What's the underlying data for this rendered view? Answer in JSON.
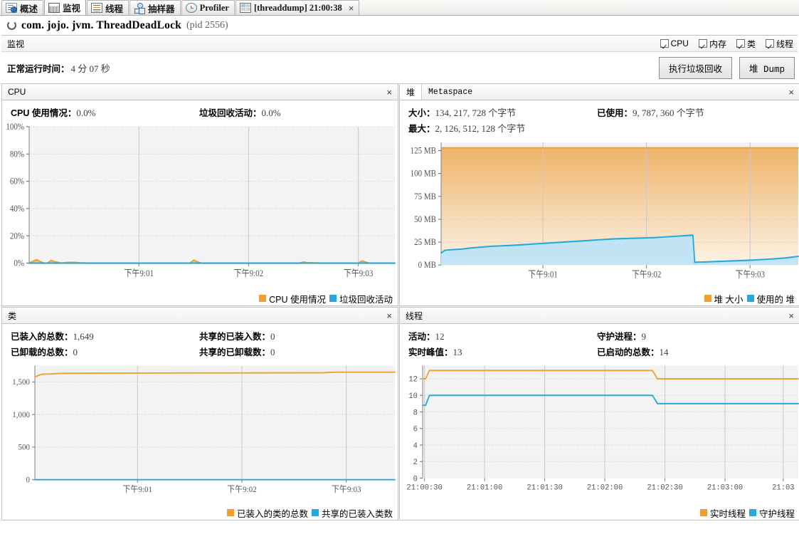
{
  "tabs": [
    {
      "label": "概述",
      "icon": "overview-icon",
      "active": false,
      "closable": false
    },
    {
      "label": "监视",
      "icon": "monitor-icon",
      "active": true,
      "closable": false
    },
    {
      "label": "线程",
      "icon": "threads-icon",
      "active": false,
      "closable": false
    },
    {
      "label": "抽样器",
      "icon": "sampler-icon",
      "active": false,
      "closable": false
    },
    {
      "label": "Profiler",
      "icon": "profiler-icon",
      "active": false,
      "closable": false
    },
    {
      "label": "[threaddump] 21:00:38",
      "icon": "threaddump-icon",
      "active": false,
      "closable": true
    }
  ],
  "tab_close_glyph": "×",
  "app": {
    "title": "com. jojo. jvm. ThreadDeadLock",
    "pid": "(pid 2556)"
  },
  "monitor_bar": {
    "label": "监视",
    "checkboxes": [
      {
        "label": "CPU",
        "checked": true
      },
      {
        "label": "内存",
        "checked": true
      },
      {
        "label": "类",
        "checked": true
      },
      {
        "label": "线程",
        "checked": true
      }
    ]
  },
  "uptime": {
    "label": "正常运行时间：",
    "value": "4 分 07 秒"
  },
  "actions": {
    "gc_button": "执行垃圾回收",
    "heapdump_button": "堆 Dump"
  },
  "panels": {
    "cpu": {
      "title": "CPU",
      "close_glyph": "×",
      "stats": [
        {
          "label": "CPU 使用情况：",
          "value": "0.0%"
        },
        {
          "label": "垃圾回收活动：",
          "value": "0.0%"
        }
      ],
      "legend": [
        {
          "label": "CPU 使用情况",
          "color": "#f0a030"
        },
        {
          "label": "垃圾回收活动",
          "color": "#27a8dd"
        }
      ]
    },
    "heap": {
      "tab_active": "堆",
      "tab_inactive": "Metaspace",
      "close_glyph": "×",
      "stats": [
        {
          "label": "大小：",
          "value": "134, 217, 728 个字节"
        },
        {
          "label": "最大：",
          "value": "2, 126, 512, 128 个字节"
        },
        {
          "label": "已使用：",
          "value": "9, 787, 360 个字节"
        }
      ],
      "legend": [
        {
          "label": "堆 大小",
          "color": "#f0a030"
        },
        {
          "label": "使用的 堆",
          "color": "#27a8dd"
        }
      ]
    },
    "classes": {
      "title": "类",
      "close_glyph": "×",
      "stats": [
        {
          "label": "已装入的总数：",
          "value": "1,649"
        },
        {
          "label": "已卸载的总数：",
          "value": "0"
        },
        {
          "label": "共享的已装入数：",
          "value": "0"
        },
        {
          "label": "共享的已卸载数：",
          "value": "0"
        }
      ],
      "legend": [
        {
          "label": "已装入的类的总数",
          "color": "#f0a030"
        },
        {
          "label": "共享的已装入类数",
          "color": "#27a8dd"
        }
      ]
    },
    "threads": {
      "title": "线程",
      "close_glyph": "×",
      "stats": [
        {
          "label": "活动：",
          "value": "12"
        },
        {
          "label": "实时峰值：",
          "value": "13"
        },
        {
          "label": "守护进程：",
          "value": "9"
        },
        {
          "label": "已启动的总数：",
          "value": "14"
        }
      ],
      "legend": [
        {
          "label": "实时线程",
          "color": "#f0a030"
        },
        {
          "label": "守护线程",
          "color": "#27a8dd"
        }
      ]
    }
  },
  "chart_data": [
    {
      "id": "cpu",
      "type": "area",
      "title": "CPU",
      "xlabel": "",
      "ylabel": "",
      "ylim": [
        0,
        100
      ],
      "yticks": [
        0,
        20,
        40,
        60,
        80,
        100
      ],
      "ytick_labels": [
        "0%",
        "20%",
        "40%",
        "60%",
        "80%",
        "100%"
      ],
      "xtick_labels": [
        "下午9:01",
        "下午9:02",
        "下午9:03"
      ],
      "xtick_positions": [
        0.3,
        0.6,
        0.9
      ],
      "grid": true,
      "series": [
        {
          "name": "CPU 使用情况",
          "color": "#f0a030",
          "x": [
            0.0,
            0.02,
            0.03,
            0.04,
            0.05,
            0.06,
            0.07,
            0.09,
            0.1,
            0.12,
            0.14,
            0.16,
            0.2,
            0.25,
            0.3,
            0.35,
            0.4,
            0.44,
            0.45,
            0.46,
            0.47,
            0.5,
            0.55,
            0.6,
            0.65,
            0.7,
            0.74,
            0.75,
            0.76,
            0.8,
            0.85,
            0.9,
            0.91,
            0.92,
            0.93,
            0.95,
            1.0
          ],
          "values": [
            0,
            2.5,
            1.2,
            0,
            0,
            2.0,
            1.0,
            0,
            0.4,
            0.6,
            0.2,
            0,
            0,
            0,
            0,
            0,
            0,
            0,
            2.2,
            1.0,
            0,
            0,
            0,
            0,
            0,
            0,
            0,
            0.8,
            0.3,
            0,
            0,
            0,
            1.6,
            0.7,
            0,
            0,
            0
          ]
        },
        {
          "name": "垃圾回收活动",
          "color": "#27a8dd",
          "x": [
            0.0,
            0.25,
            0.5,
            0.75,
            1.0
          ],
          "values": [
            0,
            0,
            0,
            0,
            0
          ]
        }
      ]
    },
    {
      "id": "heap",
      "type": "area",
      "title": "堆",
      "xlabel": "",
      "ylabel": "MB",
      "ylim": [
        0,
        134
      ],
      "yticks": [
        0,
        25,
        50,
        75,
        100,
        125
      ],
      "ytick_labels": [
        "0 MB",
        "25 MB",
        "50 MB",
        "75 MB",
        "100 MB",
        "125 MB"
      ],
      "xtick_labels": [
        "下午9:01",
        "下午9:02",
        "下午9:03"
      ],
      "xtick_positions": [
        0.285,
        0.575,
        0.865
      ],
      "grid": true,
      "series": [
        {
          "name": "堆 大小",
          "color": "#f0a030",
          "x": [
            0.0,
            1.0
          ],
          "values": [
            128,
            128
          ]
        },
        {
          "name": "使用的 堆",
          "color": "#27a8dd",
          "x": [
            0.0,
            0.01,
            0.02,
            0.04,
            0.06,
            0.08,
            0.11,
            0.14,
            0.17,
            0.2,
            0.24,
            0.28,
            0.32,
            0.36,
            0.4,
            0.44,
            0.48,
            0.52,
            0.56,
            0.6,
            0.64,
            0.66,
            0.68,
            0.7,
            0.705,
            0.71,
            0.72,
            0.74,
            0.78,
            0.82,
            0.86,
            0.9,
            0.94,
            0.97,
            1.0
          ],
          "values": [
            13,
            16,
            16.5,
            17,
            17.5,
            18.5,
            19.5,
            20.5,
            21,
            21.5,
            22.5,
            23.5,
            24.5,
            25.5,
            26.5,
            27.5,
            28.5,
            29,
            29.5,
            30,
            31,
            31.5,
            32,
            32.5,
            32.5,
            3.0,
            3.2,
            3.4,
            4.0,
            4.6,
            5.2,
            6.0,
            7.0,
            8.0,
            9.5
          ]
        }
      ]
    },
    {
      "id": "classes",
      "type": "line",
      "title": "类",
      "xlabel": "",
      "ylabel": "",
      "ylim": [
        0,
        1750
      ],
      "yticks": [
        0,
        500,
        1000,
        1500
      ],
      "ytick_labels": [
        "0",
        "500",
        "1,000",
        "1,500"
      ],
      "xtick_labels": [
        "下午9:01",
        "下午9:02",
        "下午9:03"
      ],
      "xtick_positions": [
        0.285,
        0.575,
        0.865
      ],
      "grid": true,
      "series": [
        {
          "name": "已装入的类的总数",
          "color": "#f0a030",
          "x": [
            0.0,
            0.01,
            0.02,
            0.04,
            0.07,
            0.1,
            0.2,
            0.4,
            0.6,
            0.8,
            0.82,
            0.84,
            0.86,
            0.9,
            1.0
          ],
          "values": [
            1570,
            1600,
            1618,
            1620,
            1630,
            1632,
            1634,
            1636,
            1638,
            1640,
            1646,
            1649,
            1649,
            1649,
            1649
          ]
        },
        {
          "name": "共享的已装入类数",
          "color": "#27a8dd",
          "x": [
            0.0,
            1.0
          ],
          "values": [
            0,
            0
          ]
        }
      ]
    },
    {
      "id": "threads",
      "type": "line",
      "title": "线程",
      "xlabel": "",
      "ylabel": "",
      "ylim": [
        0,
        13.6
      ],
      "yticks": [
        0,
        2,
        4,
        6,
        8,
        10,
        12
      ],
      "ytick_labels": [
        "0",
        "2",
        "4",
        "6",
        "8",
        "10",
        "12"
      ],
      "xtick_labels": [
        "21:00:30",
        "21:01:00",
        "21:01:30",
        "21:02:00",
        "21:02:30",
        "21:03:00",
        "21:03"
      ],
      "xtick_positions": [
        0.005,
        0.165,
        0.325,
        0.485,
        0.645,
        0.805,
        0.96
      ],
      "grid": true,
      "series": [
        {
          "name": "实时线程",
          "color": "#f0a030",
          "x": [
            0.0,
            0.008,
            0.018,
            0.6,
            0.612,
            0.625,
            1.0
          ],
          "values": [
            12,
            12,
            13,
            13,
            13,
            12,
            12
          ]
        },
        {
          "name": "守护线程",
          "color": "#27a8dd",
          "x": [
            0.0,
            0.008,
            0.018,
            0.6,
            0.612,
            0.625,
            1.0
          ],
          "values": [
            8.8,
            8.8,
            10,
            10,
            10,
            9,
            9
          ]
        }
      ]
    }
  ]
}
